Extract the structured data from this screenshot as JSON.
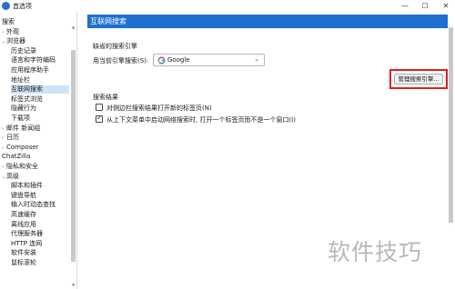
{
  "window": {
    "title": "首选项",
    "min_glyph": "—",
    "max_glyph": "☐",
    "close_glyph": "✕"
  },
  "sidebar": {
    "items": [
      {
        "label": "搜索",
        "caret": ""
      },
      {
        "label": "外观",
        "caret": "›"
      },
      {
        "label": "浏览器",
        "caret": "⌄"
      },
      {
        "label": "历史记录",
        "caret": ""
      },
      {
        "label": "语言和字符编码",
        "caret": ""
      },
      {
        "label": "应用程序助手",
        "caret": ""
      },
      {
        "label": "地址栏",
        "caret": ""
      },
      {
        "label": "互联网搜索",
        "caret": "",
        "selected": true
      },
      {
        "label": "标签式浏览",
        "caret": ""
      },
      {
        "label": "隐藏行为",
        "caret": ""
      },
      {
        "label": "下载项",
        "caret": ""
      },
      {
        "label": "邮件 新闻组",
        "caret": "›"
      },
      {
        "label": "日历",
        "caret": "›"
      },
      {
        "label": "Composer",
        "caret": "›"
      },
      {
        "label": "ChatZilla",
        "caret": ""
      },
      {
        "label": "隐私和安全",
        "caret": "›"
      },
      {
        "label": "高级",
        "caret": "⌄"
      },
      {
        "label": "脚本和插件",
        "caret": ""
      },
      {
        "label": "键盘导航",
        "caret": ""
      },
      {
        "label": "输入时动态查找",
        "caret": ""
      },
      {
        "label": "高速缓存",
        "caret": ""
      },
      {
        "label": "离线应用",
        "caret": ""
      },
      {
        "label": "代理服务器",
        "caret": ""
      },
      {
        "label": "HTTP 连网",
        "caret": ""
      },
      {
        "label": "软件安装",
        "caret": ""
      },
      {
        "label": "鼠标滚轮",
        "caret": ""
      }
    ],
    "scroll_up": "▲",
    "scroll_down": "▼"
  },
  "panel": {
    "title": "互联网搜索",
    "default_engine_group": "缺省的搜索引擎",
    "current_engine_label": "用当前引擎搜索(S):",
    "current_engine_value": "Google",
    "manage_button": "管理搜索引擎...",
    "results_group": "搜索结果",
    "options": [
      {
        "label": "对侧边栏搜索结果打开新的标签页(N)",
        "checked": false
      },
      {
        "label": "从上下文菜单中启动网络搜索时, 打开一个标签页而不是一个窗口(I)",
        "checked": true
      }
    ]
  },
  "watermark": "软件技巧",
  "colors": {
    "header_bg": "#1e6fd0",
    "selection_bg": "#cce4f7",
    "highlight_border": "#e02020"
  }
}
